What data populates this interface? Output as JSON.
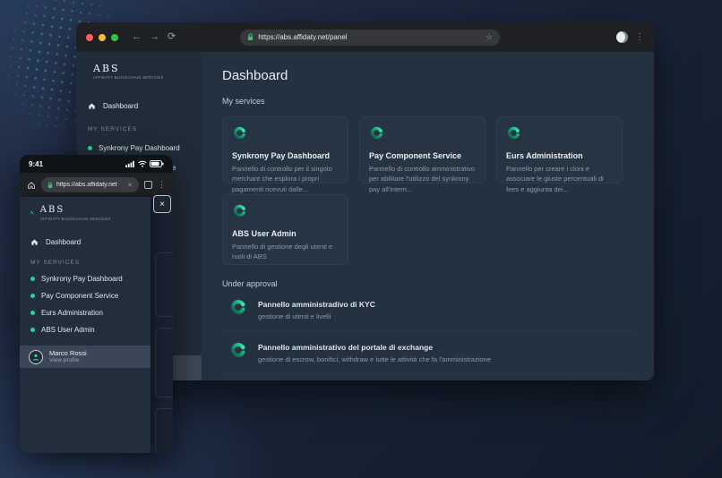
{
  "colors": {
    "accent_green": "#2bd394",
    "swirl_dark": "#0c5a48",
    "swirl_bright": "#2ee6a4",
    "traffic_red": "#ff5f57",
    "traffic_yellow": "#febc2e",
    "traffic_green": "#2ac840"
  },
  "icons": {
    "back": "←",
    "forward": "→",
    "reload": "⟳",
    "star": "☆",
    "menu_dots": "⋮",
    "close": "×",
    "url_clear": "✕"
  },
  "desktop": {
    "browser": {
      "url": "https://abs.affidaty.net/panel"
    },
    "sidebar": {
      "logo": {
        "name": "ABS",
        "subtitle": "AFFIDATY BLOCKCHAIN SERVICES"
      },
      "nav": [
        {
          "label": "Dashboard"
        }
      ],
      "section_label": "MY SERVICES",
      "services": [
        {
          "label": "Synkrony Pay Dashboard"
        },
        {
          "label": "Pay Component Service"
        }
      ]
    },
    "main": {
      "title": "Dashboard",
      "section_my_services": "My services",
      "cards": [
        {
          "title": "Synkrony Pay Dashboard",
          "description": "Pannello di controllo per il singolo merchant che esplora i propri pagamenti ricevuti dalle..."
        },
        {
          "title": "Pay Component Service",
          "description": "Pannello di controllo amministrativo per abilitare l'utilizzo del synkrony pay all'intern..."
        },
        {
          "title": "Eurs Administration",
          "description": "Pannello per creare i cloni e associare le giuste percentuali di fees e aggiunta dei..."
        },
        {
          "title": "ABS User Admin",
          "description": "Pannello di gestione degli utenti e ruoli di ABS"
        }
      ],
      "section_under_approval": "Under approval",
      "approvals": [
        {
          "title": "Pannello amministradivo di KYC",
          "subtitle": "gestione di utenti e livelli"
        },
        {
          "title": "Pannello amministrativo del portale di exchange",
          "subtitle": "gestione di escrow, bonifici, withdraw e tutte le attività che fa l'amministrazione"
        }
      ]
    }
  },
  "mobile": {
    "status": {
      "time": "9:41"
    },
    "browser": {
      "url": "https://abs.affidaty.net"
    },
    "menu": {
      "logo": {
        "name": "ABS",
        "subtitle": "AFFIDATY BLOCKCHAIN SERVICES"
      },
      "nav": [
        {
          "label": "Dashboard"
        }
      ],
      "section_label": "MY SERVICES",
      "services": [
        {
          "label": "Synkrony Pay Dashboard"
        },
        {
          "label": "Pay Component Service"
        },
        {
          "label": "Eurs Administration"
        },
        {
          "label": "ABS User Admin"
        }
      ],
      "profile": {
        "name": "Marco Rossi",
        "action": "View profile"
      }
    }
  }
}
